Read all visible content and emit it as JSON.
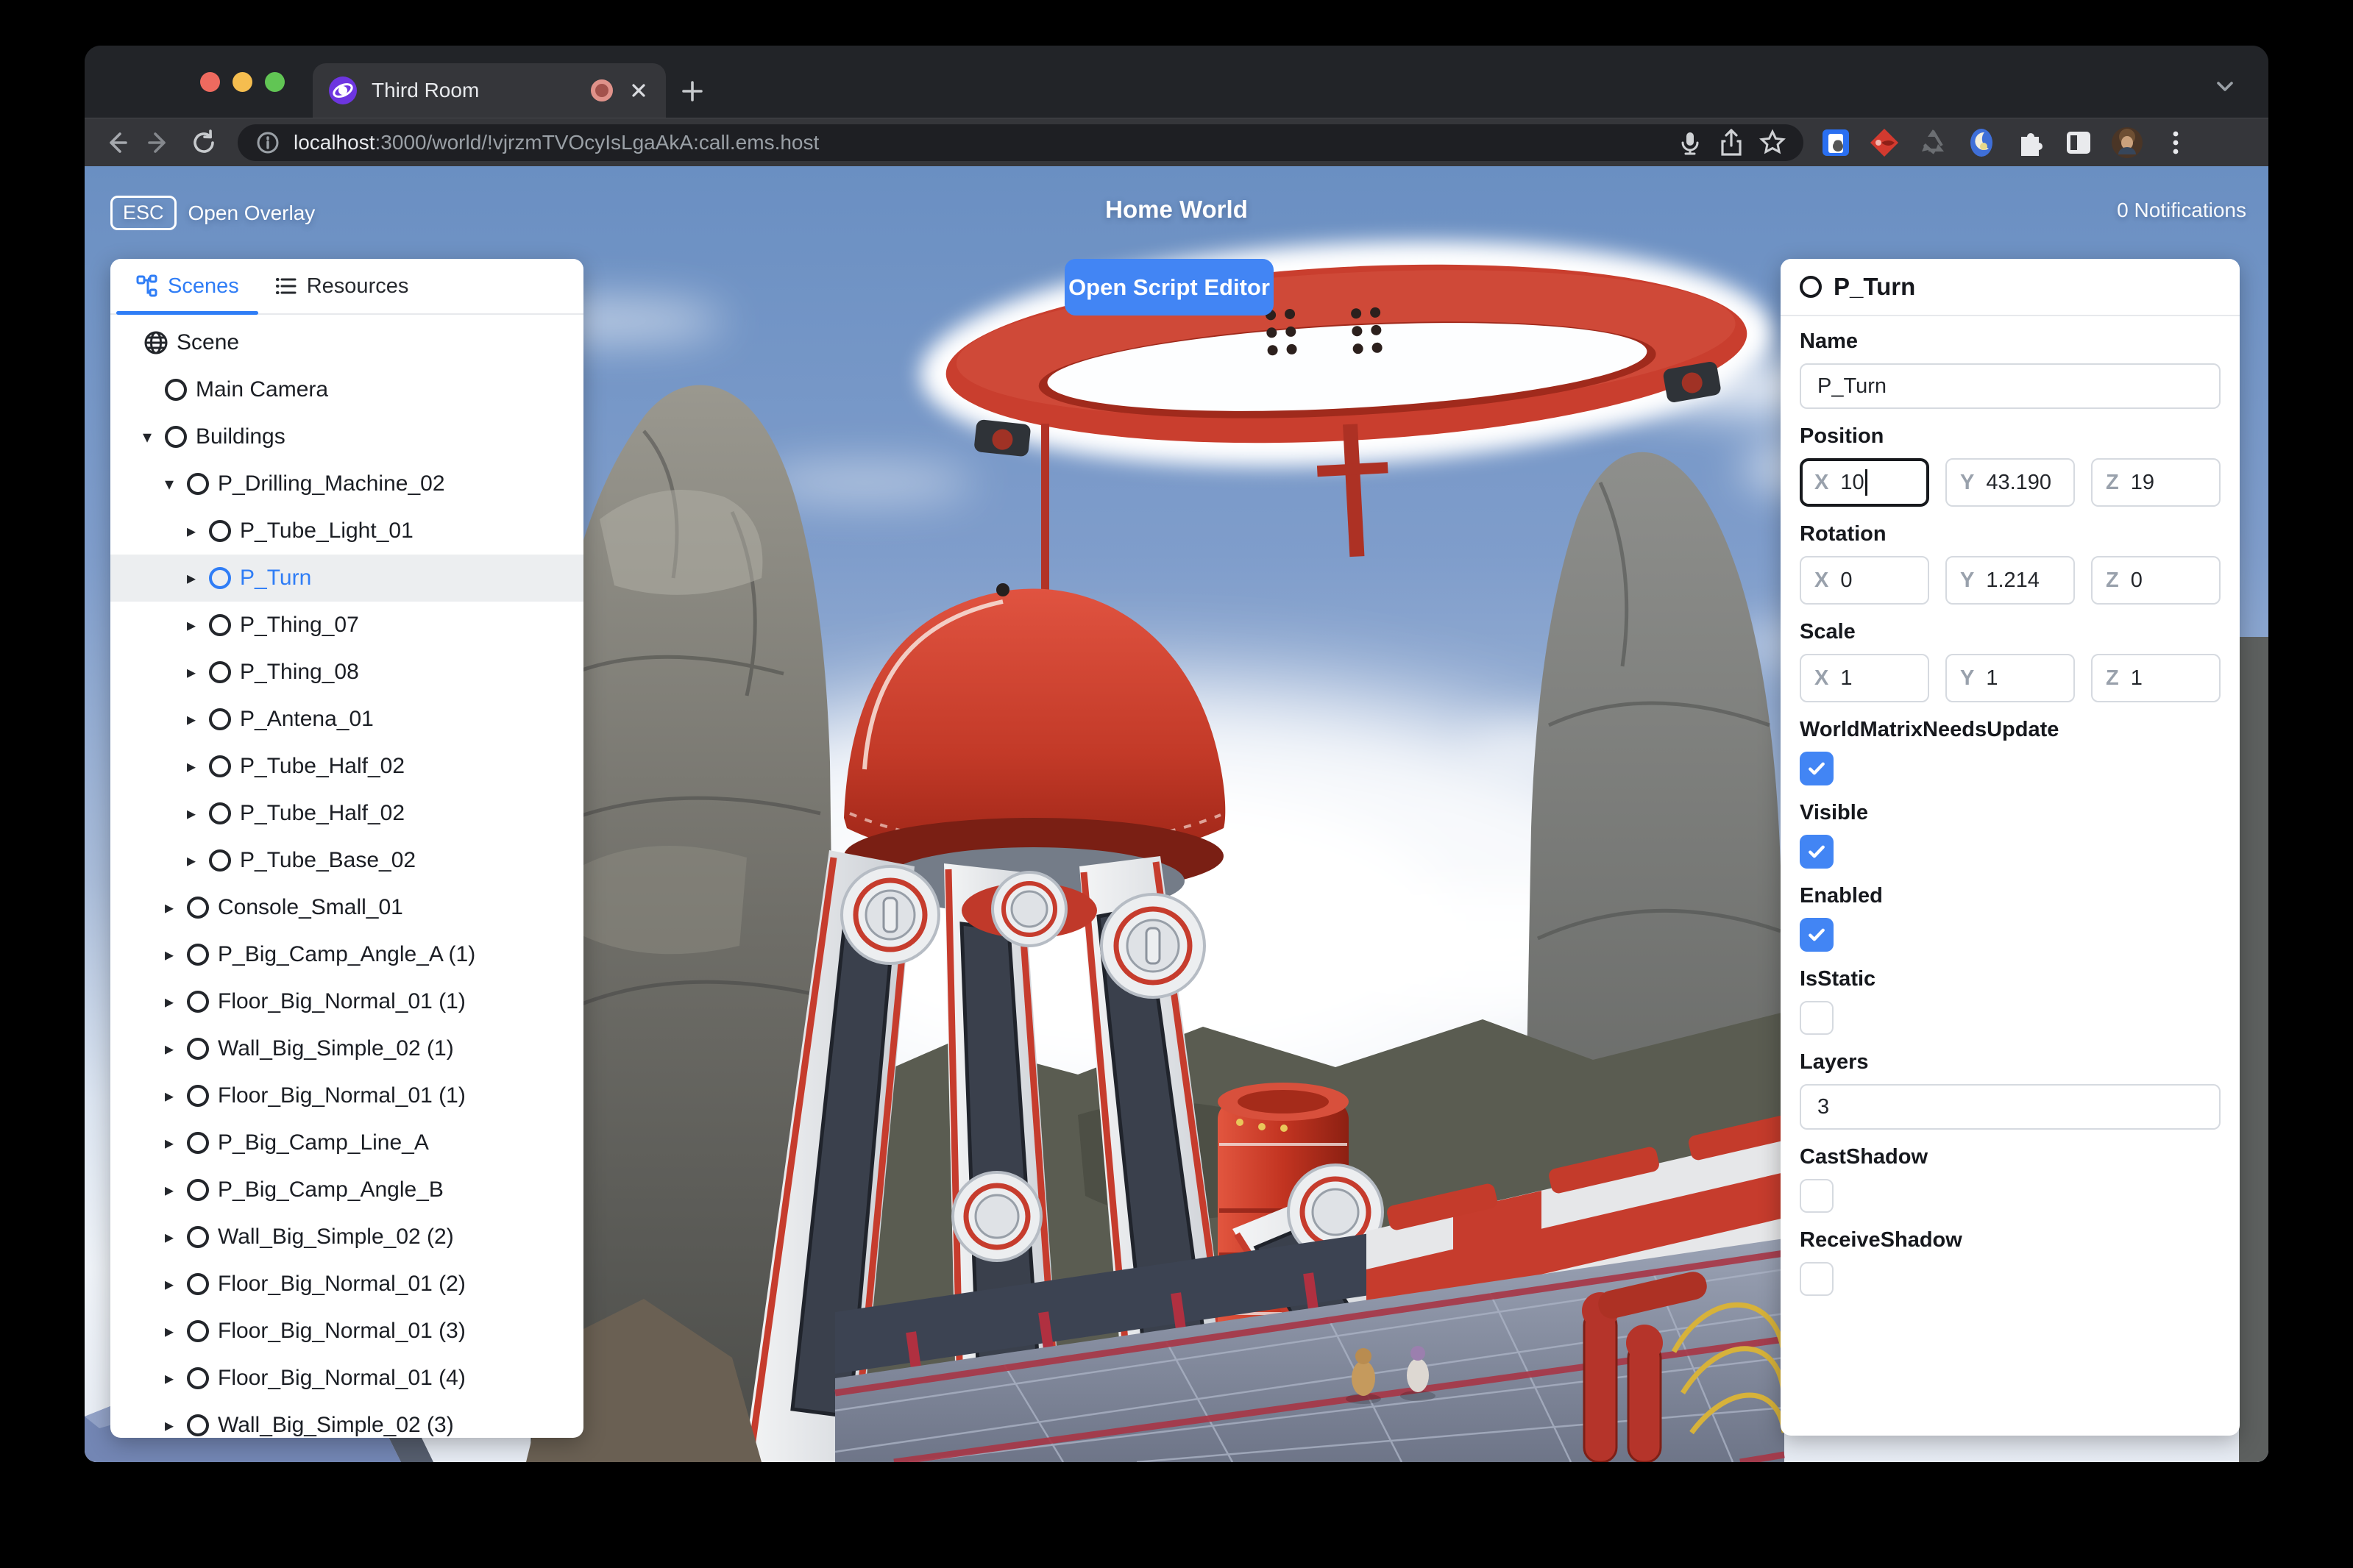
{
  "browser": {
    "tab": {
      "title": "Third Room"
    },
    "url": {
      "host": "localhost",
      "rest": ":3000/world/!vjrzmTVOcyIsLgaAkA:call.ems.host"
    },
    "traffic_lights": {
      "close": "#ee6a5f",
      "minimize": "#f5bd4f",
      "zoom": "#61c554"
    },
    "accent": "#4285f4"
  },
  "hud": {
    "esc_key": "ESC",
    "esc_label": "Open Overlay",
    "world_title": "Home World",
    "notifications": "0 Notifications",
    "script_editor_button": "Open Script Editor"
  },
  "scene_panel": {
    "tabs": [
      {
        "label": "Scenes",
        "active": true
      },
      {
        "label": "Resources",
        "active": false
      }
    ],
    "tree": [
      {
        "label": "Scene",
        "level": 0,
        "icon": "globe",
        "caret": null,
        "selected": false
      },
      {
        "label": "Main Camera",
        "level": 1,
        "icon": "circle",
        "caret": null,
        "selected": false
      },
      {
        "label": "Buildings",
        "level": 1,
        "icon": "circle",
        "caret": "down",
        "selected": false
      },
      {
        "label": "P_Drilling_Machine_02",
        "level": 2,
        "icon": "circle",
        "caret": "down",
        "selected": false
      },
      {
        "label": "P_Tube_Light_01",
        "level": 3,
        "icon": "circle",
        "caret": "right",
        "selected": false
      },
      {
        "label": "P_Turn",
        "level": 3,
        "icon": "circle",
        "caret": "right",
        "selected": true
      },
      {
        "label": "P_Thing_07",
        "level": 3,
        "icon": "circle",
        "caret": "right",
        "selected": false
      },
      {
        "label": "P_Thing_08",
        "level": 3,
        "icon": "circle",
        "caret": "right",
        "selected": false
      },
      {
        "label": "P_Antena_01",
        "level": 3,
        "icon": "circle",
        "caret": "right",
        "selected": false
      },
      {
        "label": "P_Tube_Half_02",
        "level": 3,
        "icon": "circle",
        "caret": "right",
        "selected": false
      },
      {
        "label": "P_Tube_Half_02",
        "level": 3,
        "icon": "circle",
        "caret": "right",
        "selected": false
      },
      {
        "label": "P_Tube_Base_02",
        "level": 3,
        "icon": "circle",
        "caret": "right",
        "selected": false
      },
      {
        "label": "Console_Small_01",
        "level": 2,
        "icon": "circle",
        "caret": "right",
        "selected": false
      },
      {
        "label": "P_Big_Camp_Angle_A (1)",
        "level": 2,
        "icon": "circle",
        "caret": "right",
        "selected": false
      },
      {
        "label": "Floor_Big_Normal_01 (1)",
        "level": 2,
        "icon": "circle",
        "caret": "right",
        "selected": false
      },
      {
        "label": "Wall_Big_Simple_02 (1)",
        "level": 2,
        "icon": "circle",
        "caret": "right",
        "selected": false
      },
      {
        "label": "Floor_Big_Normal_01 (1)",
        "level": 2,
        "icon": "circle",
        "caret": "right",
        "selected": false
      },
      {
        "label": "P_Big_Camp_Line_A",
        "level": 2,
        "icon": "circle",
        "caret": "right",
        "selected": false
      },
      {
        "label": "P_Big_Camp_Angle_B",
        "level": 2,
        "icon": "circle",
        "caret": "right",
        "selected": false
      },
      {
        "label": "Wall_Big_Simple_02 (2)",
        "level": 2,
        "icon": "circle",
        "caret": "right",
        "selected": false
      },
      {
        "label": "Floor_Big_Normal_01 (2)",
        "level": 2,
        "icon": "circle",
        "caret": "right",
        "selected": false
      },
      {
        "label": "Floor_Big_Normal_01 (3)",
        "level": 2,
        "icon": "circle",
        "caret": "right",
        "selected": false
      },
      {
        "label": "Floor_Big_Normal_01 (4)",
        "level": 2,
        "icon": "circle",
        "caret": "right",
        "selected": false
      },
      {
        "label": "Wall_Big_Simple_02 (3)",
        "level": 2,
        "icon": "circle",
        "caret": "right",
        "selected": false
      }
    ]
  },
  "inspector": {
    "title": "P_Turn",
    "properties": [
      {
        "type": "text",
        "label": "Name",
        "value": "P_Turn"
      },
      {
        "type": "vector3",
        "label": "Position",
        "x": "10",
        "y": "43.190",
        "z": "19",
        "focused": "x"
      },
      {
        "type": "vector3",
        "label": "Rotation",
        "x": "0",
        "y": "1.214",
        "z": "0",
        "focused": null
      },
      {
        "type": "vector3",
        "label": "Scale",
        "x": "1",
        "y": "1",
        "z": "1",
        "focused": null
      },
      {
        "type": "checkbox",
        "label": "WorldMatrixNeedsUpdate",
        "checked": true
      },
      {
        "type": "checkbox",
        "label": "Visible",
        "checked": true
      },
      {
        "type": "checkbox",
        "label": "Enabled",
        "checked": true
      },
      {
        "type": "checkbox",
        "label": "IsStatic",
        "checked": false
      },
      {
        "type": "text",
        "label": "Layers",
        "value": "3"
      },
      {
        "type": "checkbox",
        "label": "CastShadow",
        "checked": false
      },
      {
        "type": "checkbox",
        "label": "ReceiveShadow",
        "checked": false
      }
    ]
  }
}
